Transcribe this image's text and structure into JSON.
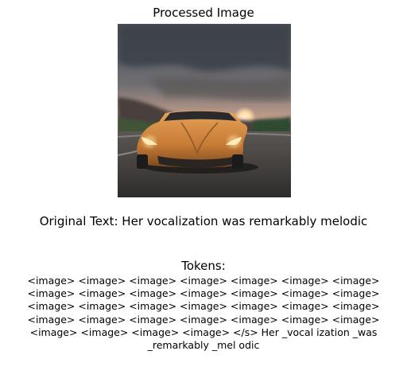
{
  "image_title": "Processed Image",
  "original_text": "Original Text: Her vocalization was remarkably melodic",
  "tokens_title": "Tokens:",
  "token_lines": [
    "<image> <image> <image> <image> <image> <image> <image>",
    "<image> <image> <image> <image> <image> <image> <image>",
    "<image> <image> <image> <image> <image> <image> <image>",
    "<image> <image> <image> <image> <image> <image> <image>",
    "<image> <image> <image> <image> </s> Her _vocal ization _was",
    "_remarkably _mel odic"
  ]
}
